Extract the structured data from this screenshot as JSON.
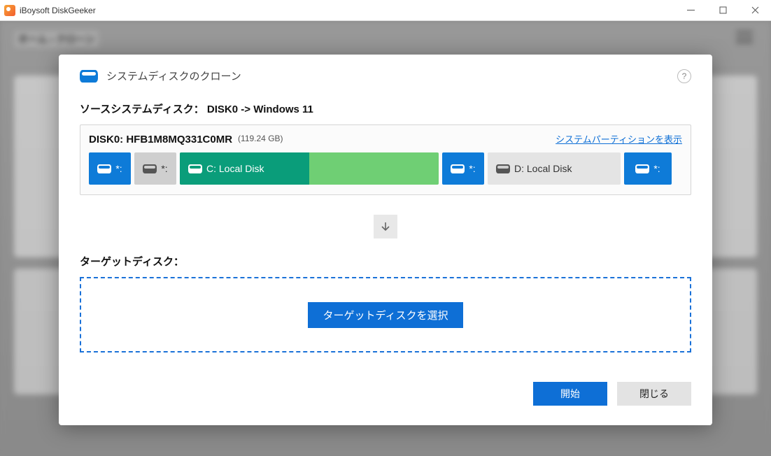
{
  "window": {
    "title": "iBoysoft DiskGeeker"
  },
  "breadcrumb": "ホーム › クローン",
  "modal": {
    "title": "システムディスクのクローン",
    "help_tooltip": "?"
  },
  "source": {
    "label": "ソースシステムディスク： DISK0 -> Windows 11",
    "disk_name": "DISK0: HFB1M8MQ331C0MR",
    "disk_size": "(119.24 GB)",
    "show_system_partitions": "システムパーティションを表示",
    "partitions": [
      {
        "label": "*:",
        "type": "blue"
      },
      {
        "label": "*:",
        "type": "grey"
      },
      {
        "label": "C: Local Disk",
        "type": "c",
        "fill_percent": 50
      },
      {
        "label": "*:",
        "type": "blue"
      },
      {
        "label": "D: Local Disk",
        "type": "d"
      },
      {
        "label": "*:",
        "type": "blue"
      }
    ]
  },
  "target": {
    "label": "ターゲットディスク：",
    "select_button": "ターゲットディスクを選択"
  },
  "buttons": {
    "start": "開始",
    "close": "閉じる"
  }
}
